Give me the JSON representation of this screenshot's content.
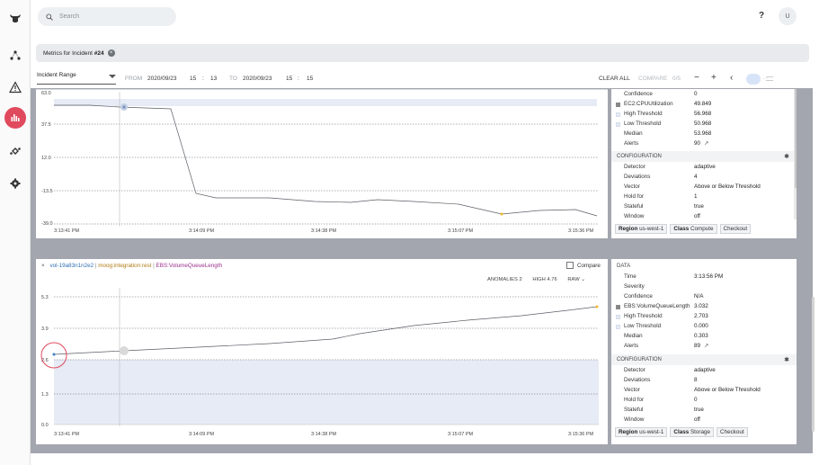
{
  "rail": {
    "items": [
      {
        "icon": "moogsoft-logo-icon"
      },
      {
        "icon": "topology-icon"
      },
      {
        "icon": "alert-triangle-icon"
      },
      {
        "icon": "metrics-chart-icon"
      },
      {
        "icon": "integrations-icon"
      },
      {
        "icon": "settings-gear-icon"
      }
    ],
    "active_color": "#e04a5d"
  },
  "topbar": {
    "search_placeholder": "Search",
    "help": "?",
    "avatar": "U"
  },
  "chip": {
    "prefix": "Metrics for Incident ",
    "number": "#24"
  },
  "controls": {
    "range": "Incident Range",
    "from_label": "FROM",
    "from_date": "2020/09/23",
    "from_hour": "15",
    "from_sep": ":",
    "from_min": "13",
    "to_label": "TO",
    "to_date": "2020/09/23",
    "to_hour": "15",
    "to_sep": ":",
    "to_min": "15",
    "clear_all": "CLEAR ALL",
    "compare": "COMPARE",
    "compare_count": "0/5",
    "minus": "−",
    "plus": "+",
    "prev": "‹",
    "next": "›",
    "more": "···"
  },
  "chart1": {
    "y_ticks": [
      "63.0",
      "37.5",
      "12.0",
      "-13.5",
      "-39.0"
    ],
    "x_ticks": [
      "3:13:41 PM",
      "3:14:09 PM",
      "3:14:38 PM",
      "3:15:07 PM",
      "3:15:36 PM"
    ]
  },
  "panel1": {
    "rows": [
      {
        "label": "Confidence",
        "value": "0"
      },
      {
        "label": "EC2:CPUUtilization",
        "value": "49.849",
        "legend": "#888888"
      },
      {
        "label": "High Threshold",
        "value": "56.968",
        "legend": "#e6ebf5"
      },
      {
        "label": "Low Threshold",
        "value": "50.968",
        "legend": "#e6ebf5"
      },
      {
        "label": "Median",
        "value": "53.968"
      },
      {
        "label": "Alerts",
        "value": "90",
        "ext": "↗"
      }
    ],
    "config_title": "CONFIGURATION",
    "config": [
      {
        "label": "Detector",
        "value": "adaptive"
      },
      {
        "label": "Deviations",
        "value": "4"
      },
      {
        "label": "Vector",
        "value": "Above or Below Threshold"
      },
      {
        "label": "Hold for",
        "value": "1"
      },
      {
        "label": "Stateful",
        "value": "true"
      },
      {
        "label": "Window",
        "value": "off"
      }
    ],
    "tags": [
      {
        "key": "Region",
        "value": "us-west-1"
      },
      {
        "key": "Class",
        "value": "Compute"
      },
      {
        "key": "",
        "value": "Checkout"
      }
    ]
  },
  "chart2": {
    "close": "×",
    "name_a": "vol-19a83n1n2e2",
    "name_sep": " | ",
    "name_b": "moog:integration:rest",
    "name_c": "EBS:VolumeQueueLength",
    "compare_label": "Compare",
    "anomalies_label": "ANOMALIES",
    "anomalies": "2",
    "high_label": "HIGH",
    "high": "4.76",
    "mode": "RAW",
    "y_ticks": [
      "5.3",
      "3.9",
      "2.6",
      "1.3",
      "0.0"
    ],
    "x_ticks": [
      "3:13:41 PM",
      "3:14:09 PM",
      "3:14:38 PM",
      "3:15:07 PM",
      "3:15:36 PM"
    ]
  },
  "panel2": {
    "data_title": "DATA",
    "rows": [
      {
        "label": "Time",
        "value": "3:13:56 PM"
      },
      {
        "label": "Severity",
        "value": ""
      },
      {
        "label": "Confidence",
        "value": "N/A"
      },
      {
        "label": "EBS:VolumeQueueLength",
        "value": "3.032",
        "legend": "#888888"
      },
      {
        "label": "High Threshold",
        "value": "2.703",
        "legend": "#e6ebf5"
      },
      {
        "label": "Low Threshold",
        "value": "0.000",
        "legend": "#e6ebf5"
      },
      {
        "label": "Median",
        "value": "0.303"
      },
      {
        "label": "Alerts",
        "value": "89",
        "ext": "↗"
      }
    ],
    "config_title": "CONFIGURATION",
    "config": [
      {
        "label": "Detector",
        "value": "adaptive"
      },
      {
        "label": "Deviations",
        "value": "8"
      },
      {
        "label": "Vector",
        "value": "Above or Below Threshold"
      },
      {
        "label": "Hold for",
        "value": "0"
      },
      {
        "label": "Stateful",
        "value": "true"
      },
      {
        "label": "Window",
        "value": "off"
      }
    ],
    "tags": [
      {
        "key": "Region",
        "value": "us-west-1"
      },
      {
        "key": "Class",
        "value": "Storage"
      },
      {
        "key": "",
        "value": "Checkout"
      }
    ]
  },
  "colors": {
    "accent": "#e04a5d",
    "anomaly": "#f3b72b",
    "band": "#e6ebf5",
    "point": "#3b82c4"
  }
}
